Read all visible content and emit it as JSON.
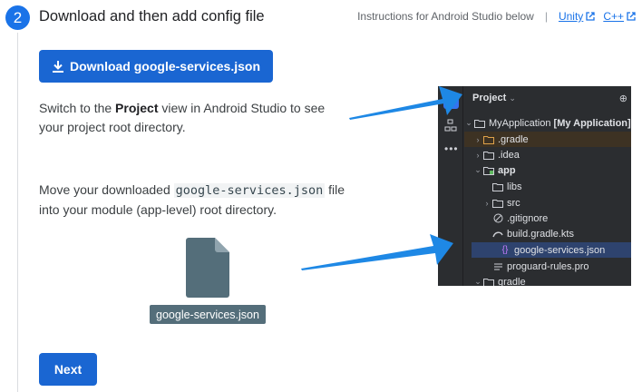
{
  "step": {
    "number": "2",
    "title": "Download and then add config file"
  },
  "links": {
    "instructions": "Instructions for Android Studio below",
    "separator": "|",
    "unity": "Unity",
    "cpp": "C++"
  },
  "download_button": {
    "label": "Download google-services.json",
    "icon": "download-icon"
  },
  "instruction1": {
    "before": "Switch to the ",
    "bold": "Project",
    "after": " view in Android Studio to see your project root directory."
  },
  "instruction2": {
    "before": "Move your downloaded ",
    "code": "google-services.json",
    "after": " file into your module (app-level) root directory."
  },
  "file_graphic": {
    "label": "google-services.json",
    "icon": "file-icon"
  },
  "next_button": {
    "label": "Next"
  },
  "ide": {
    "panel_title": "Project",
    "tree": {
      "root_name": "MyApplication",
      "root_suffix": "[My Application]",
      "gradle_dir": ".gradle",
      "idea_dir": ".idea",
      "app_dir": "app",
      "libs_dir": "libs",
      "src_dir": "src",
      "gitignore": ".gitignore",
      "build_file": "build.gradle.kts",
      "services_file": "google-services.json",
      "proguard_file": "proguard-rules.pro",
      "gradle_dir2": "gradle"
    }
  },
  "colors": {
    "accent": "#1a73e8",
    "button": "#1a66d2",
    "arrow": "#1e88e5",
    "file_grey": "#546e7a"
  }
}
